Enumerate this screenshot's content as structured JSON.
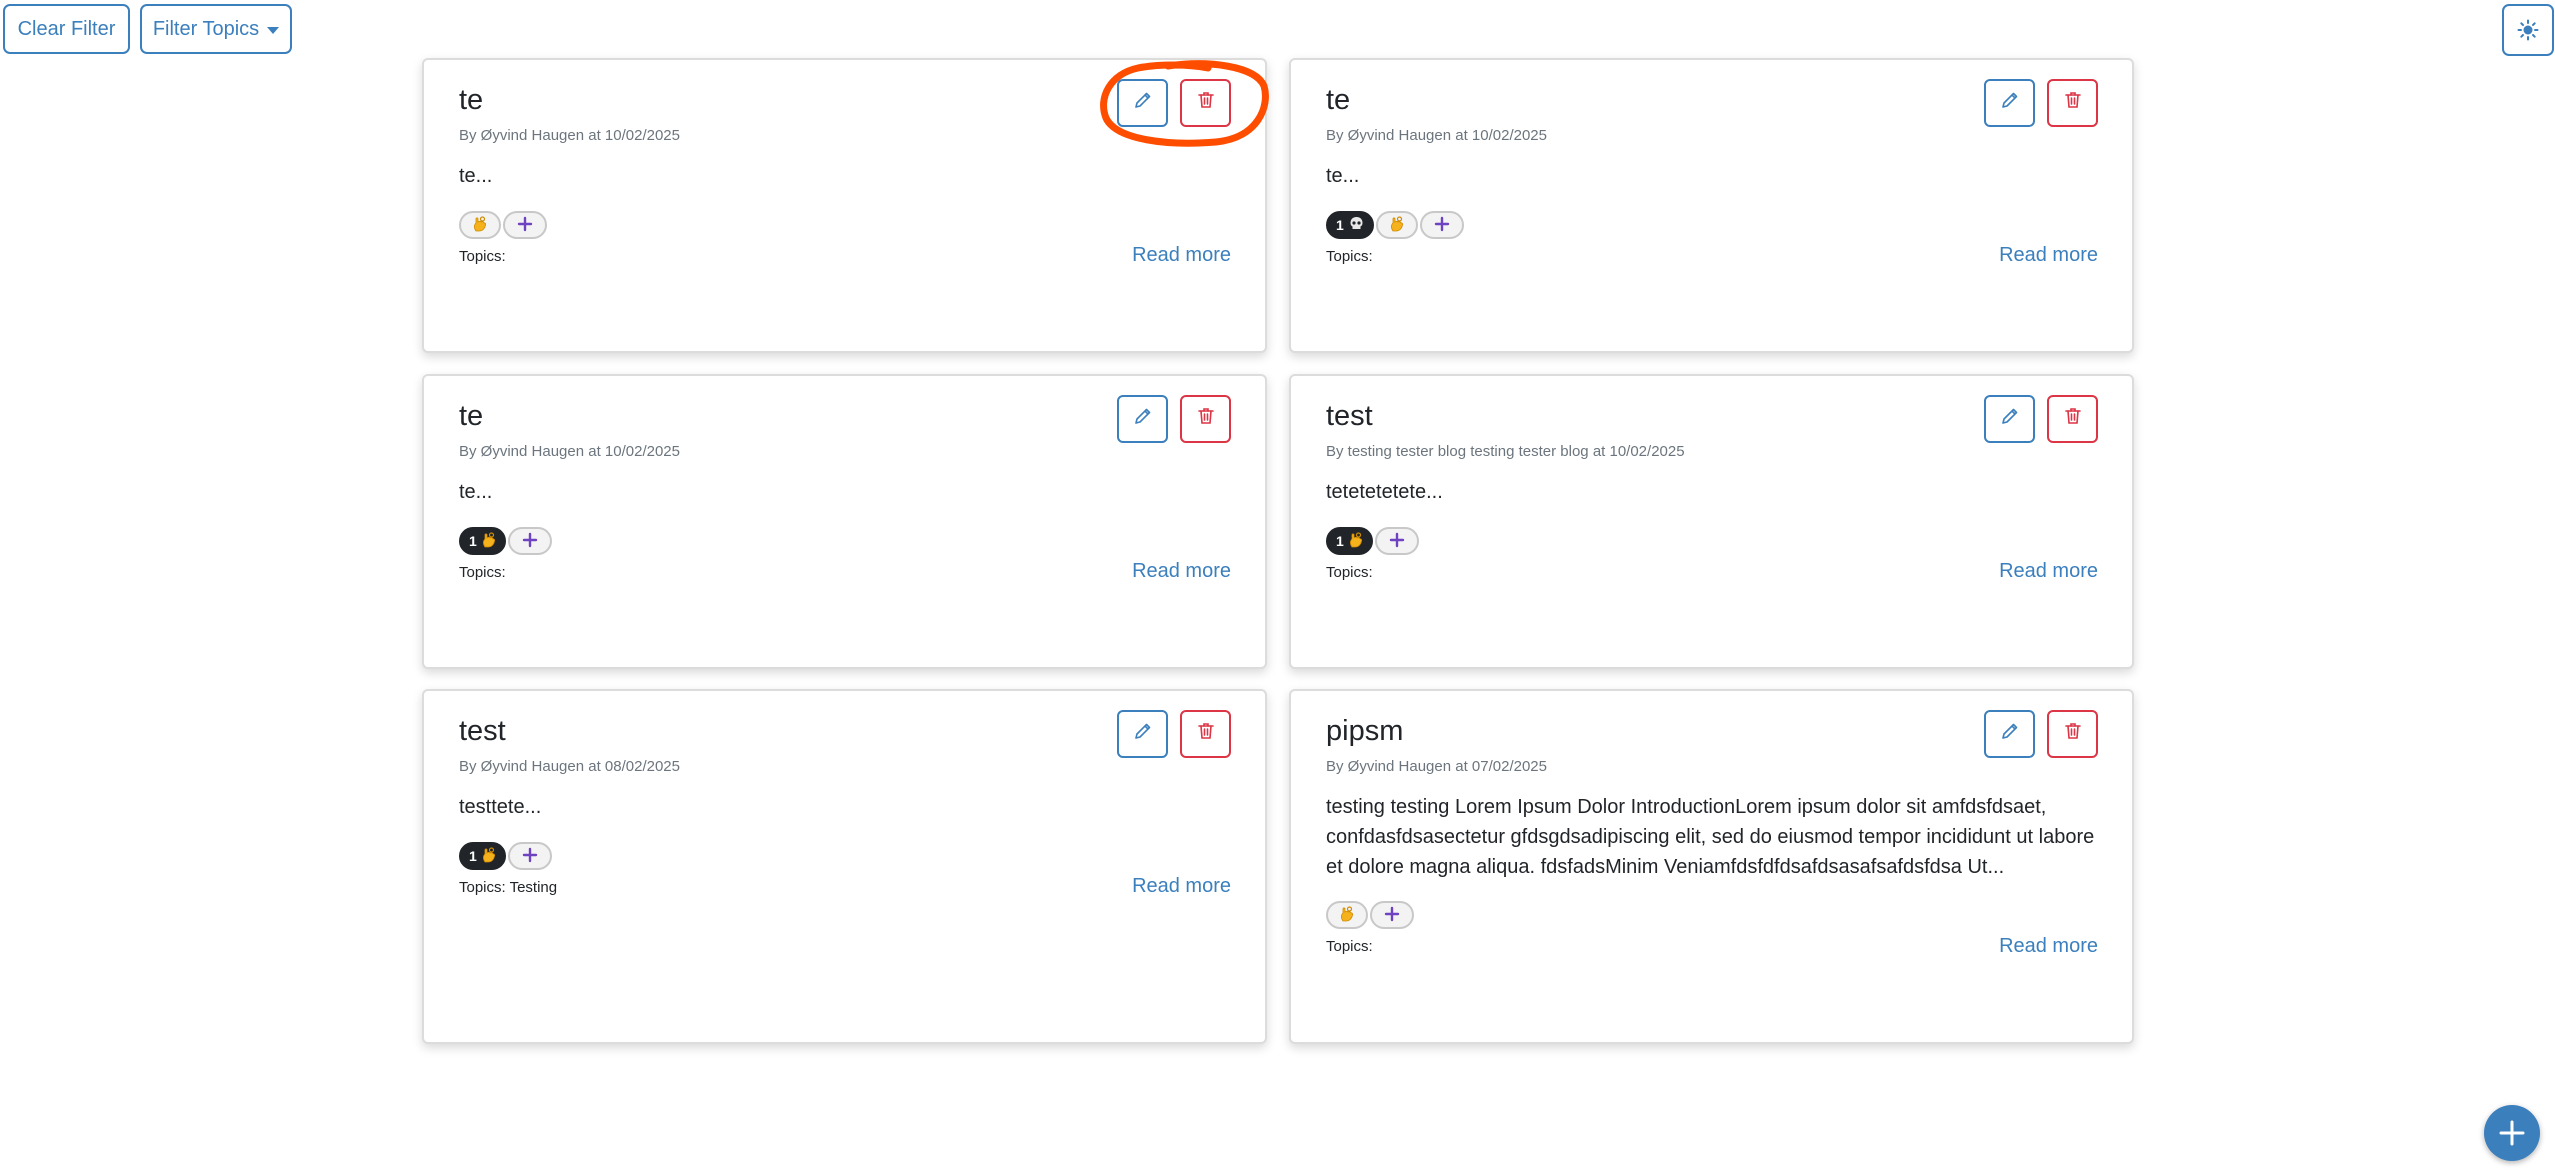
{
  "toolbar": {
    "clear_filter_label": "Clear Filter",
    "filter_topics_label": "Filter Topics",
    "theme_toggle_icon": "sun-icon"
  },
  "posts": [
    {
      "title": "te",
      "meta": "By Øyvind Haugen at 10/02/2025",
      "excerpt": "te...",
      "reactions": [
        {
          "count": "",
          "icon": "ok-hand-emoji"
        }
      ],
      "topics": "Topics:",
      "read_more": "Read more"
    },
    {
      "title": "te",
      "meta": "By Øyvind Haugen at 10/02/2025",
      "excerpt": "te...",
      "reactions": [
        {
          "count": "1",
          "icon": "skull-emoji"
        },
        {
          "count": "",
          "icon": "ok-hand-emoji"
        }
      ],
      "topics": "Topics:",
      "read_more": "Read more"
    },
    {
      "title": "te",
      "meta": "By Øyvind Haugen at 10/02/2025",
      "excerpt": "te...",
      "reactions": [
        {
          "count": "1",
          "icon": "ok-hand-emoji"
        }
      ],
      "topics": "Topics:",
      "read_more": "Read more"
    },
    {
      "title": "test",
      "meta": "By testing tester blog testing tester blog at 10/02/2025",
      "excerpt": "tetetetetete...",
      "reactions": [
        {
          "count": "1",
          "icon": "ok-hand-emoji"
        }
      ],
      "topics": "Topics:",
      "read_more": "Read more"
    },
    {
      "title": "test",
      "meta": "By Øyvind Haugen at 08/02/2025",
      "excerpt": "testtete...",
      "reactions": [
        {
          "count": "1",
          "icon": "ok-hand-emoji"
        }
      ],
      "topics": "Topics: Testing",
      "read_more": "Read more"
    },
    {
      "title": "pipsm",
      "meta": "By Øyvind Haugen at 07/02/2025",
      "excerpt": "testing testing Lorem Ipsum Dolor IntroductionLorem ipsum dolor sit amfdsfdsaet, confdasfdsasectetur gfdsgdsadipiscing elit, sed do eiusmod tempor incididunt ut labore et dolore magna aliqua. fdsfadsMinim Veniamfdsfdfdsafdsasafsafdsfdsa Ut...",
      "reactions": [
        {
          "count": "",
          "icon": "ok-hand-emoji"
        }
      ],
      "topics": "Topics:",
      "read_more": "Read more"
    }
  ],
  "colors": {
    "primary": "#3b7fbd",
    "danger": "#dc3545",
    "annotation": "#ff4d00",
    "dark_pill": "#212529"
  }
}
